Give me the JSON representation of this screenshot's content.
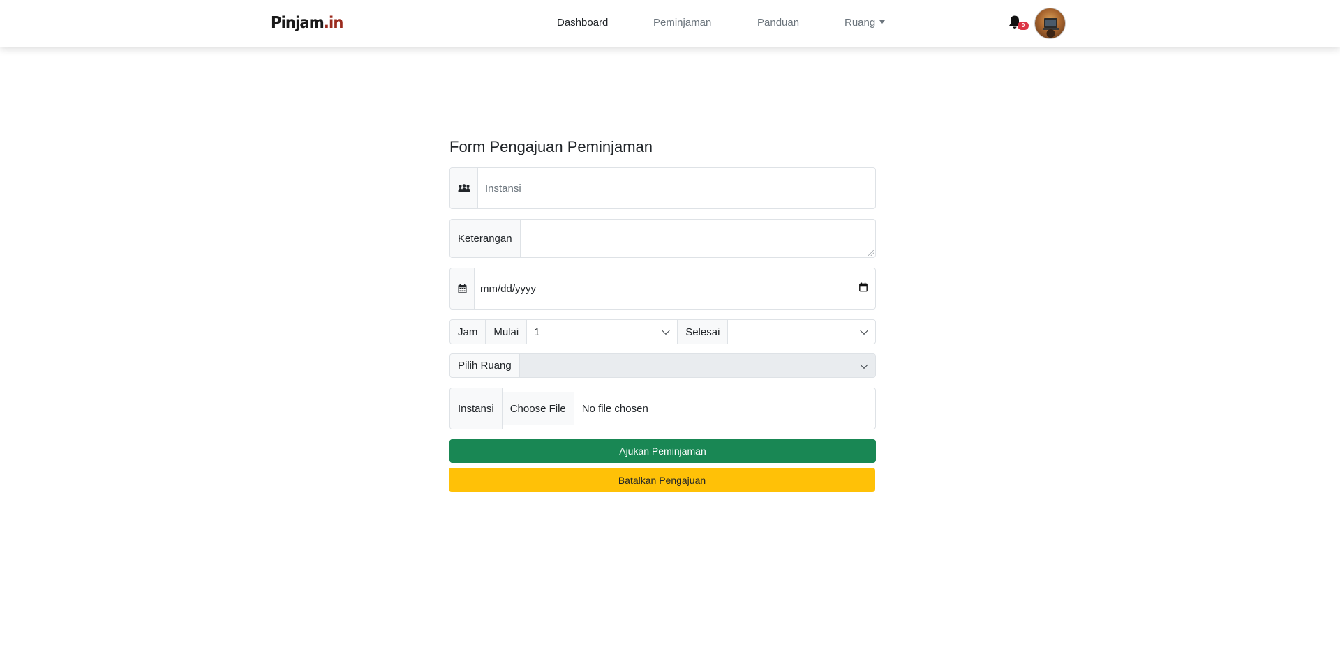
{
  "brand": {
    "name": "Pinjam",
    "suffix": ".in"
  },
  "nav": {
    "items": [
      {
        "label": "Dashboard",
        "active": true
      },
      {
        "label": "Peminjaman",
        "active": false
      },
      {
        "label": "Panduan",
        "active": false
      },
      {
        "label": "Ruang",
        "active": false,
        "dropdown": true
      }
    ],
    "notification_count": "0",
    "icons": {
      "bell": "bell-icon",
      "avatar": "user-avatar"
    }
  },
  "form": {
    "title": "Form Pengajuan Peminjaman",
    "instansi": {
      "icon": "users-icon",
      "placeholder": "Instansi",
      "value": ""
    },
    "keterangan": {
      "label": "Keterangan",
      "value": ""
    },
    "tanggal": {
      "icon": "calendar-icon",
      "placeholder": "mm/dd/yyyy"
    },
    "jam": {
      "label": "Jam",
      "mulai_label": "Mulai",
      "mulai_value": "1",
      "selesai_label": "Selesai",
      "selesai_value": ""
    },
    "ruang": {
      "label": "Pilih Ruang",
      "value": ""
    },
    "file": {
      "label": "Instansi",
      "button": "Choose File",
      "status": "No file chosen"
    },
    "submit_label": "Ajukan Peminjaman",
    "cancel_label": "Batalkan Pengajuan"
  },
  "colors": {
    "success": "#198754",
    "warning": "#ffc107",
    "danger": "#dc3545",
    "brand_accent": "#9b2b1e"
  }
}
